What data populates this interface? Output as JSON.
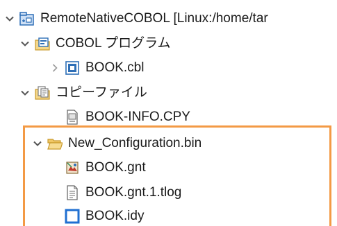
{
  "tree": {
    "items": [
      {
        "label": "RemoteNativeCOBOL [Linux:/home/tar",
        "icon": "remote-project-icon",
        "expanded": true
      },
      {
        "label": "COBOL プログラム",
        "icon": "cobol-program-folder-icon",
        "expanded": true
      },
      {
        "label": "BOOK.cbl",
        "icon": "cobol-source-icon",
        "expanded": false
      },
      {
        "label": "コピーファイル",
        "icon": "copy-file-folder-icon",
        "expanded": true
      },
      {
        "label": "BOOK-INFO.CPY",
        "icon": "copybook-file-icon"
      },
      {
        "label": "New_Configuration.bin",
        "icon": "open-folder-icon",
        "expanded": true
      },
      {
        "label": "BOOK.gnt",
        "icon": "gnt-file-icon"
      },
      {
        "label": "BOOK.gnt.1.tlog",
        "icon": "text-file-icon"
      },
      {
        "label": "BOOK.idy",
        "icon": "idy-file-icon"
      }
    ]
  },
  "colors": {
    "highlight_border": "#f39a45",
    "chevron": "#555555",
    "project_blue": "#2e6fb7",
    "folder_yellow": "#e8b84a"
  }
}
